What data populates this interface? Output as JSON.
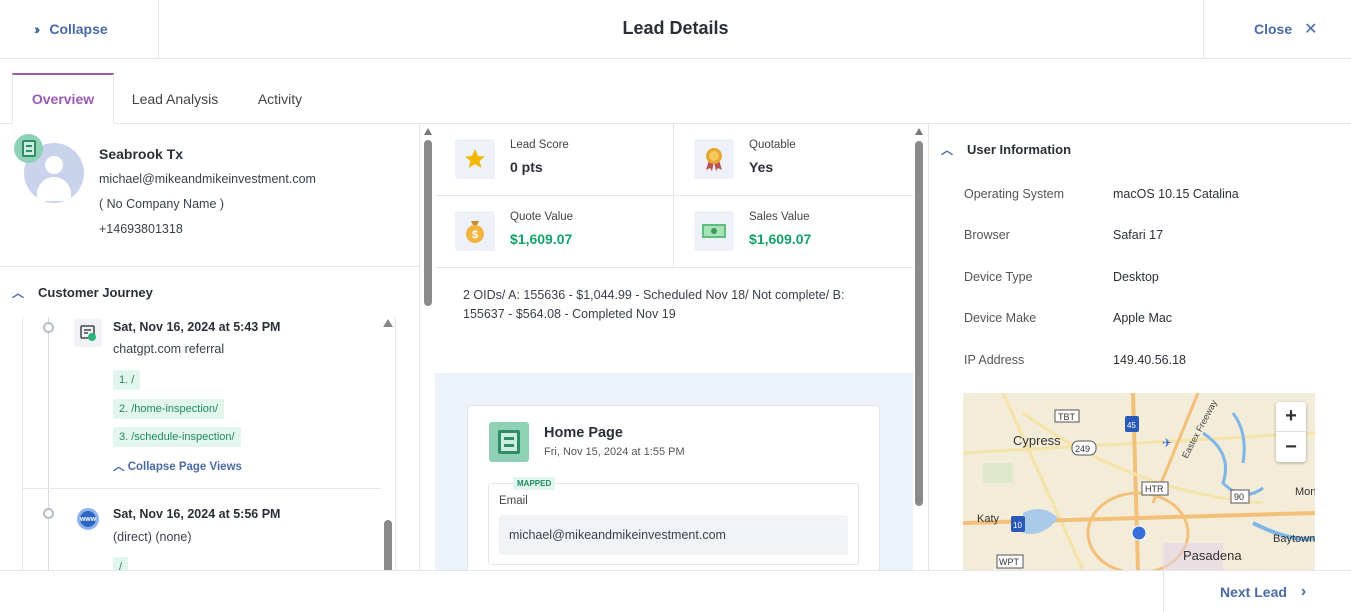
{
  "header": {
    "collapse_label": "Collapse",
    "title": "Lead Details",
    "close_label": "Close"
  },
  "tabs": [
    {
      "label": "Overview",
      "active": true
    },
    {
      "label": "Lead Analysis",
      "active": false
    },
    {
      "label": "Activity",
      "active": false
    }
  ],
  "profile": {
    "name": "Seabrook Tx",
    "email": "michael@mikeandmikeinvestment.com",
    "company": "( No Company Name )",
    "phone": "+14693801318"
  },
  "journey": {
    "title": "Customer Journey",
    "events": [
      {
        "title": "Sat, Nov 16, 2024 at 5:43 PM",
        "source": "chatgpt.com referral",
        "pages": [
          "1. /",
          "2. /home-inspection/",
          "3. /schedule-inspection/"
        ],
        "collapse_label": "Collapse Page Views"
      },
      {
        "title": "Sat, Nov 16, 2024 at 5:56 PM",
        "source": "(direct) (none)",
        "pages": [
          "/"
        ]
      }
    ]
  },
  "stats": {
    "lead_score": {
      "label": "Lead Score",
      "value": "0 pts"
    },
    "quotable": {
      "label": "Quotable",
      "value": "Yes"
    },
    "quote_value": {
      "label": "Quote Value",
      "value": "$1,609.07"
    },
    "sales_value": {
      "label": "Sales Value",
      "value": "$1,609.07"
    }
  },
  "note": "2 OIDs/ A: 155636 - $1,044.99 - Scheduled Nov 18/ Not complete/ B: 155637 - $564.08 - Completed Nov 19",
  "form_card": {
    "title": "Home Page",
    "date": "Fri, Nov 15, 2024 at 1:55 PM",
    "mapped_badge": "MAPPED",
    "field_label": "Email",
    "field_value": "michael@mikeandmikeinvestment.com"
  },
  "user_info": {
    "title": "User Information",
    "rows": [
      {
        "label": "Operating System",
        "value": "macOS 10.15 Catalina"
      },
      {
        "label": "Browser",
        "value": "Safari 17"
      },
      {
        "label": "Device Type",
        "value": "Desktop"
      },
      {
        "label": "Device Make",
        "value": "Apple Mac"
      },
      {
        "label": "IP Address",
        "value": "149.40.56.18"
      }
    ]
  },
  "map": {
    "labels": [
      "Cypress",
      "Katy",
      "Pasadena",
      "Baytown",
      "Mon",
      "Eastex Freeway"
    ],
    "shields": [
      "TBT",
      "45",
      "249",
      "HTR",
      "90",
      "10",
      "WPT"
    ],
    "zoom_in": "+",
    "zoom_out": "−"
  },
  "footer": {
    "next_label": "Next Lead"
  },
  "colors": {
    "accent_purple": "#9b59b6",
    "link_blue": "#4a6aa5",
    "money_green": "#16a06a"
  }
}
